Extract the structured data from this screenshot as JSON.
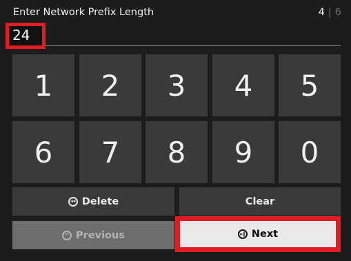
{
  "header": {
    "title": "Enter Network Prefix Length",
    "step_current": "4",
    "step_separator": "|",
    "step_total": "6"
  },
  "input": {
    "value": "24"
  },
  "keypad": {
    "keys": [
      "1",
      "2",
      "3",
      "4",
      "5",
      "6",
      "7",
      "8",
      "9",
      "0"
    ]
  },
  "actions": {
    "delete_label": "Delete",
    "clear_label": "Clear",
    "previous_label": "Previous",
    "next_label": "Next"
  },
  "icons": {
    "delete": "rewind-circle-icon",
    "previous": "undo-circle-icon",
    "next": "play-pause-circle-icon"
  },
  "colors": {
    "background": "#1c1c1c",
    "key": "#3a3a3a",
    "highlight": "#e31c23",
    "focused_button": "#e9e9e9",
    "disabled_button": "#6e6e6e"
  }
}
